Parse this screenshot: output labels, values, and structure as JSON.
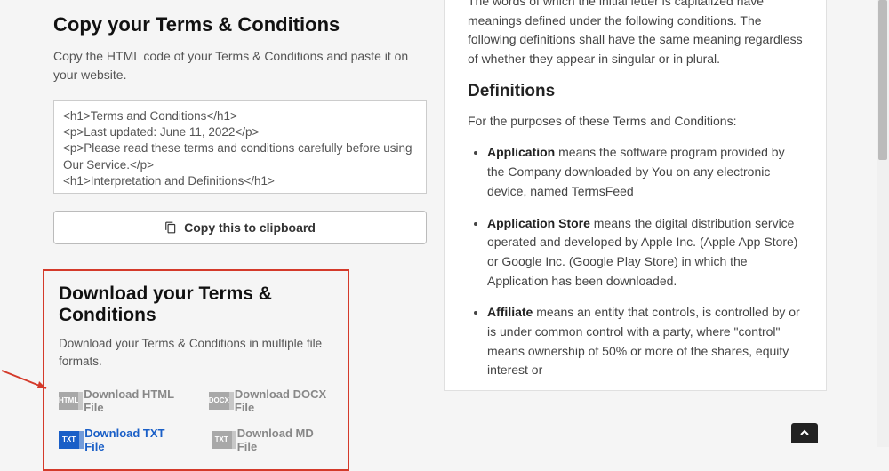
{
  "copy_section": {
    "title": "Copy your Terms & Conditions",
    "subtext": "Copy the HTML code of your Terms & Conditions and paste it on your website.",
    "code": "<h1>Terms and Conditions</h1>\n<p>Last updated: June 11, 2022</p>\n<p>Please read these terms and conditions carefully before using Our Service.</p>\n<h1>Interpretation and Definitions</h1>",
    "button_label": "Copy this to clipboard"
  },
  "download_section": {
    "title": "Download your Terms & Conditions",
    "subtext": "Download your Terms & Conditions in multiple file formats.",
    "items": [
      {
        "label": "Download HTML File",
        "icon_text": "HTML",
        "style": "gray"
      },
      {
        "label": "Download DOCX File",
        "icon_text": "DOCX",
        "style": "gray"
      },
      {
        "label": "Download TXT File",
        "icon_text": "TXT",
        "style": "blue"
      },
      {
        "label": "Download MD File",
        "icon_text": "TXT",
        "style": "gray"
      }
    ]
  },
  "preview": {
    "intro": "The words of which the initial letter is capitalized have meanings defined under the following conditions. The following definitions shall have the same meaning regardless of whether they appear in singular or in plural.",
    "definitions_heading": "Definitions",
    "definitions_lead": "For the purposes of these Terms and Conditions:",
    "defs": {
      "application_term": "Application",
      "application_body": " means the software program provided by the Company downloaded by You on any electronic device, named TermsFeed",
      "appstore_term": "Application Store",
      "appstore_body": " means the digital distribution service operated and developed by Apple Inc. (Apple App Store) or Google Inc. (Google Play Store) in which the Application has been downloaded.",
      "affiliate_term": "Affiliate",
      "affiliate_body": " means an entity that controls, is controlled by or is under common control with a party, where \"control\" means ownership of 50% or more of the shares, equity interest or"
    }
  }
}
